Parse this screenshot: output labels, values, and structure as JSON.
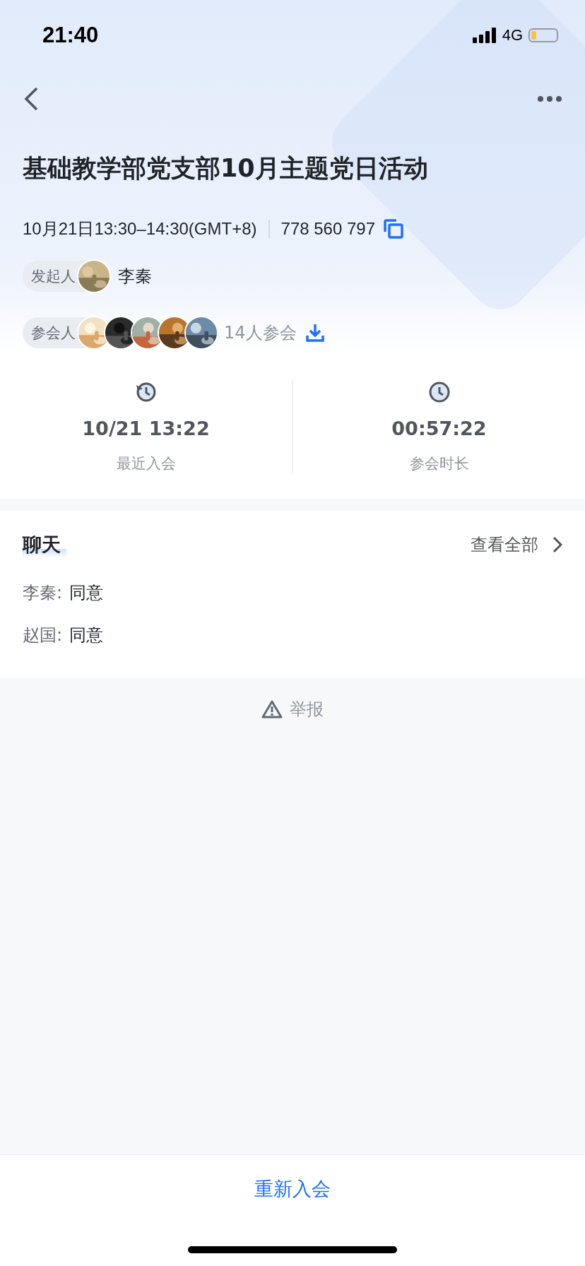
{
  "status_bar": {
    "time": "21:40",
    "network": "4G"
  },
  "meeting": {
    "title": "基础教学部党支部10月主题党日活动",
    "time": "10月21日13:30–14:30(GMT+8)",
    "meeting_id": "778 560 797",
    "initiator": {
      "label": "发起人",
      "name": "李秦"
    },
    "participants": {
      "label": "参会人",
      "count": "14人参会"
    }
  },
  "stats": [
    {
      "kind": "recent",
      "value": "10/21 13:22",
      "label": "最近入会"
    },
    {
      "kind": "duration",
      "value": "00:57:22",
      "label": "参会时长"
    }
  ],
  "chat": {
    "title": "聊天",
    "view_all": "查看全部",
    "messages": [
      {
        "sender": "李秦:",
        "text": "同意"
      },
      {
        "sender": "赵国:",
        "text": "同意"
      }
    ]
  },
  "report": "举报",
  "rejoin_button": "重新入会"
}
